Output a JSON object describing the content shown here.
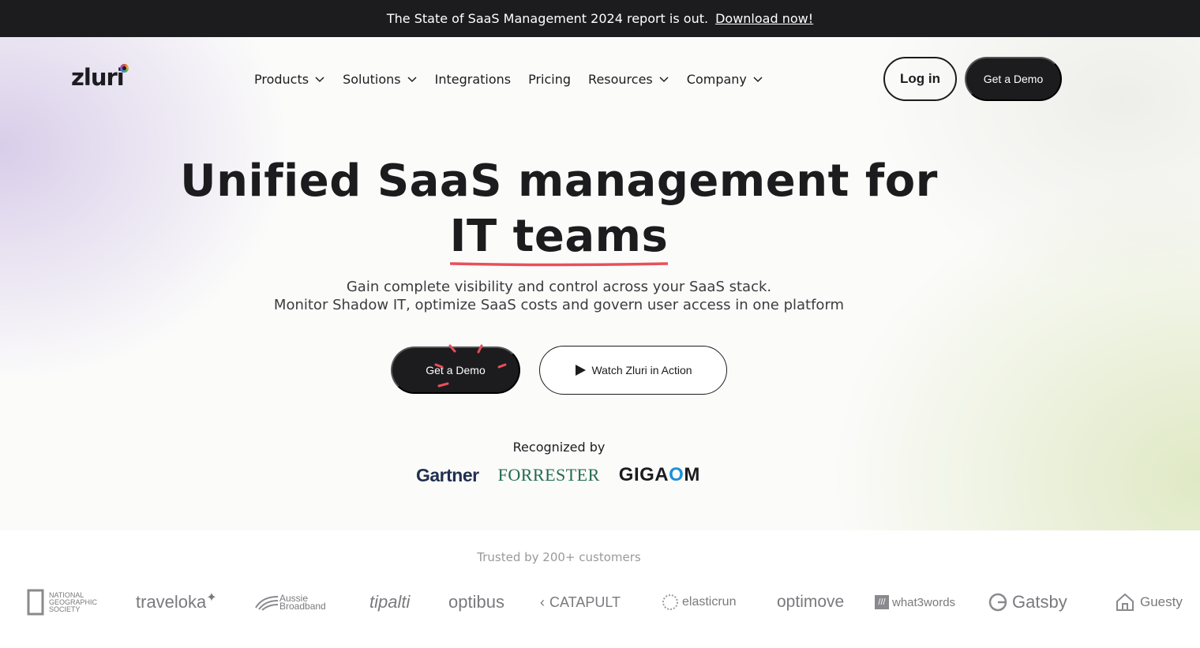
{
  "announcement": {
    "text": "The State of SaaS Management 2024 report is out.",
    "link": "Download now!"
  },
  "header": {
    "logo": "zluri",
    "nav": [
      {
        "label": "Products",
        "dropdown": true
      },
      {
        "label": "Solutions",
        "dropdown": true
      },
      {
        "label": "Integrations",
        "dropdown": false
      },
      {
        "label": "Pricing",
        "dropdown": false
      },
      {
        "label": "Resources",
        "dropdown": true
      },
      {
        "label": "Company",
        "dropdown": true
      }
    ],
    "login_label": "Log in",
    "demo_label": "Get a Demo"
  },
  "hero": {
    "headline_line1": "Unified SaaS management for",
    "headline_line2": "IT teams",
    "subtitle_line1": "Gain complete visibility and control across your SaaS stack.",
    "subtitle_line2": "Monitor Shadow IT, optimize SaaS costs and govern user access in one platform",
    "cta_demo": "Get a Demo",
    "cta_watch": "Watch Zluri in Action",
    "recognized": "Recognized by",
    "analysts": [
      "Gartner",
      "FORRESTER",
      "GIGAOM"
    ]
  },
  "customers": {
    "heading": "Trusted by 200+ customers",
    "logos": [
      "NATIONAL GEOGRAPHIC SOCIETY",
      "traveloka",
      "Aussie Broadband",
      "tipalti",
      "optibus",
      "CATAPULT",
      "elasticrun",
      "optimove",
      "what3words",
      "Gatsby",
      "Guesty"
    ]
  },
  "colors": {
    "dark": "#1c1c1f",
    "accent_underline": "#e8505b",
    "gigaom_accent": "#1a8fd8"
  }
}
